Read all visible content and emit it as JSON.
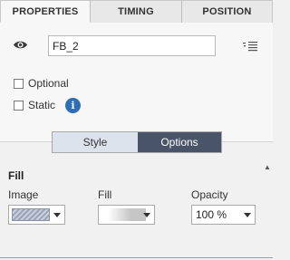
{
  "tabs": [
    {
      "label": "PROPERTIES",
      "active": true
    },
    {
      "label": "TIMING",
      "active": false
    },
    {
      "label": "POSITION",
      "active": false
    }
  ],
  "object": {
    "name_value": "FB_2",
    "visibility_icon": "eye-icon",
    "menu_icon": "list-menu-icon"
  },
  "options": {
    "optional_label": "Optional",
    "optional_checked": false,
    "static_label": "Static",
    "static_checked": false,
    "info_icon": "info-icon",
    "info_glyph": "i"
  },
  "segmented": {
    "style_label": "Style",
    "options_label": "Options",
    "selected": "Options"
  },
  "fill_section": {
    "header": "Fill",
    "image_label": "Image",
    "fill_label": "Fill",
    "opacity_label": "Opacity",
    "opacity_value": "100 %"
  },
  "colors": {
    "accent": "#4a5468",
    "info_blue": "#2f6eb5"
  }
}
